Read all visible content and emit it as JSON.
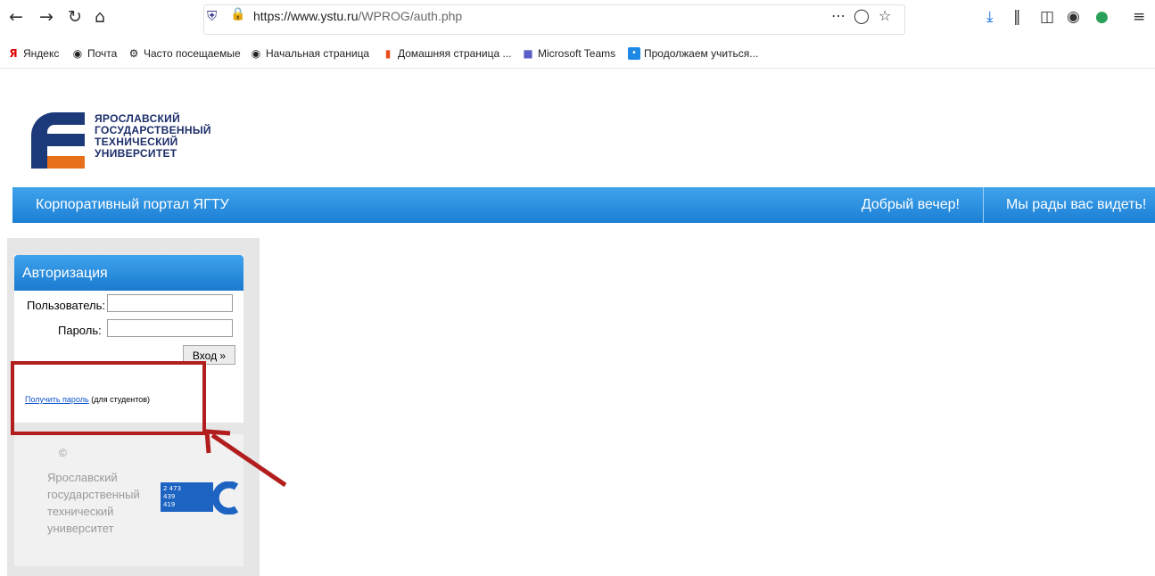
{
  "browser": {
    "url_host": "https://www.ystu.ru",
    "url_path": "/WPROG/auth.php",
    "nav_icons": [
      "back-icon",
      "forward-icon",
      "reload-icon",
      "home-icon"
    ],
    "bookmarks": [
      {
        "label": "Яндекс",
        "icon": "yandex-icon"
      },
      {
        "label": "Почта",
        "icon": "globe-icon"
      },
      {
        "label": "Часто посещаемые",
        "icon": "gear-icon"
      },
      {
        "label": "Начальная страница",
        "icon": "globe-icon"
      },
      {
        "label": "Домашняя страница ...",
        "icon": "office-icon"
      },
      {
        "label": "Microsoft Teams",
        "icon": "teams-icon"
      },
      {
        "label": "Продолжаем учиться...",
        "icon": "learning-icon"
      }
    ]
  },
  "logo": {
    "line1": "ЯРОСЛАВСКИЙ",
    "line2": "ГОСУДАРСТВЕННЫЙ",
    "line3": "ТЕХНИЧЕСКИЙ",
    "line4": "УНИВЕРСИТЕТ"
  },
  "banner": {
    "title": "Корпоративный портал ЯГТУ",
    "greeting": "Добрый вечер!",
    "welcome": "Мы рады вас видеть!"
  },
  "auth": {
    "title": "Авторизация",
    "user_label": "Пользователь:",
    "user_value": "",
    "password_label": "Пароль:",
    "password_value": "",
    "login_button": "Вход »",
    "get_password_link": "Получить пароль",
    "get_password_note": " (для студентов)"
  },
  "footer": {
    "copyright_symbol": "©",
    "org_line1": "Ярославский",
    "org_line2": "государственный",
    "org_line3": "технический",
    "org_line4": "университет",
    "counter_values": [
      "2 473",
      "439",
      "419"
    ]
  },
  "colors": {
    "banner_blue": "#1c7fd5",
    "annotation_red": "#b21e1e",
    "logo_orange": "#e8701a",
    "logo_navy": "#1c3a7a"
  }
}
